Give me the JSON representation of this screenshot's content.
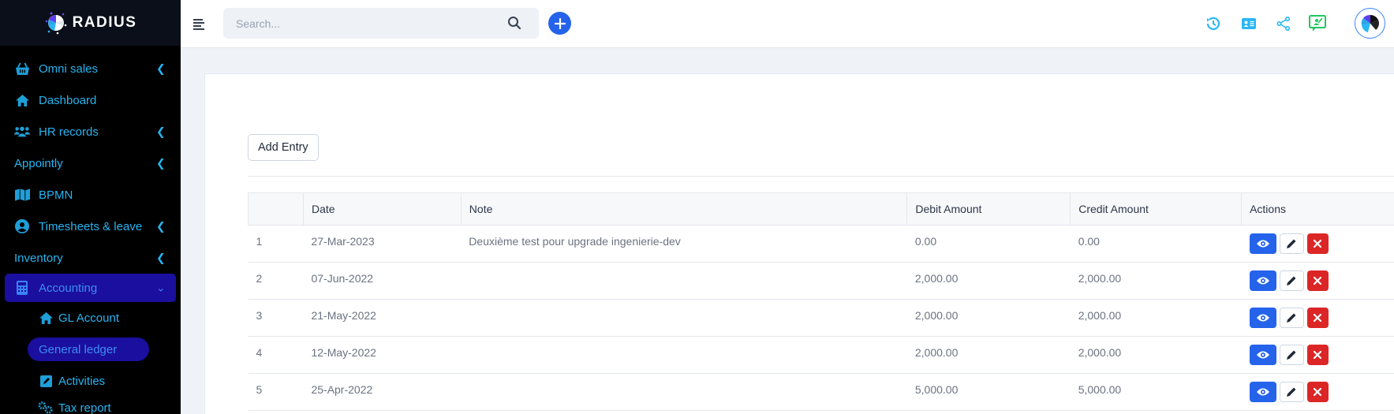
{
  "brand": {
    "name": "RADIUS"
  },
  "sidebar": {
    "items": [
      {
        "label": "Omni sales",
        "icon": "basket-icon",
        "has_chevron": true
      },
      {
        "label": "Dashboard",
        "icon": "home-icon",
        "has_chevron": false
      },
      {
        "label": "HR records",
        "icon": "users-icon",
        "has_chevron": true
      },
      {
        "label": "Appointly",
        "icon": "",
        "has_chevron": true
      },
      {
        "label": "BPMN",
        "icon": "map-icon",
        "has_chevron": false
      },
      {
        "label": "Timesheets & leave",
        "icon": "user-circle-icon",
        "has_chevron": true
      },
      {
        "label": "Inventory",
        "icon": "",
        "has_chevron": true
      },
      {
        "label": "Accounting",
        "icon": "calculator-icon",
        "has_chevron": true,
        "active": true
      }
    ],
    "sub_items": [
      {
        "label": "GL Account",
        "icon": "home-icon"
      },
      {
        "label": "General ledger",
        "icon": "",
        "active": true
      },
      {
        "label": "Activities",
        "icon": "edit-square-icon"
      },
      {
        "label": "Tax report",
        "icon": "gears-icon"
      }
    ]
  },
  "topbar": {
    "search_placeholder": "Search...",
    "icons": [
      "history-icon",
      "id-card-icon",
      "share-icon",
      "presentation-icon"
    ]
  },
  "main": {
    "add_entry_label": "Add Entry",
    "table": {
      "columns": [
        "",
        "Date",
        "Note",
        "Debit Amount",
        "Credit Amount",
        "Actions"
      ],
      "rows": [
        {
          "num": "1",
          "date": "27-Mar-2023",
          "note": "Deuxième test pour upgrade ingenierie-dev",
          "debit": "0.00",
          "credit": "0.00"
        },
        {
          "num": "2",
          "date": "07-Jun-2022",
          "note": "",
          "debit": "2,000.00",
          "credit": "2,000.00"
        },
        {
          "num": "3",
          "date": "21-May-2022",
          "note": "",
          "debit": "2,000.00",
          "credit": "2,000.00"
        },
        {
          "num": "4",
          "date": "12-May-2022",
          "note": "",
          "debit": "2,000.00",
          "credit": "2,000.00"
        },
        {
          "num": "5",
          "date": "25-Apr-2022",
          "note": "",
          "debit": "5,000.00",
          "credit": "5,000.00"
        }
      ]
    }
  },
  "colors": {
    "sidebar_bg": "#000000",
    "sidebar_text": "#27b4f0",
    "active_bg": "#1a0f9e",
    "primary": "#2563eb",
    "danger": "#dc2626",
    "success": "#22c55e"
  }
}
